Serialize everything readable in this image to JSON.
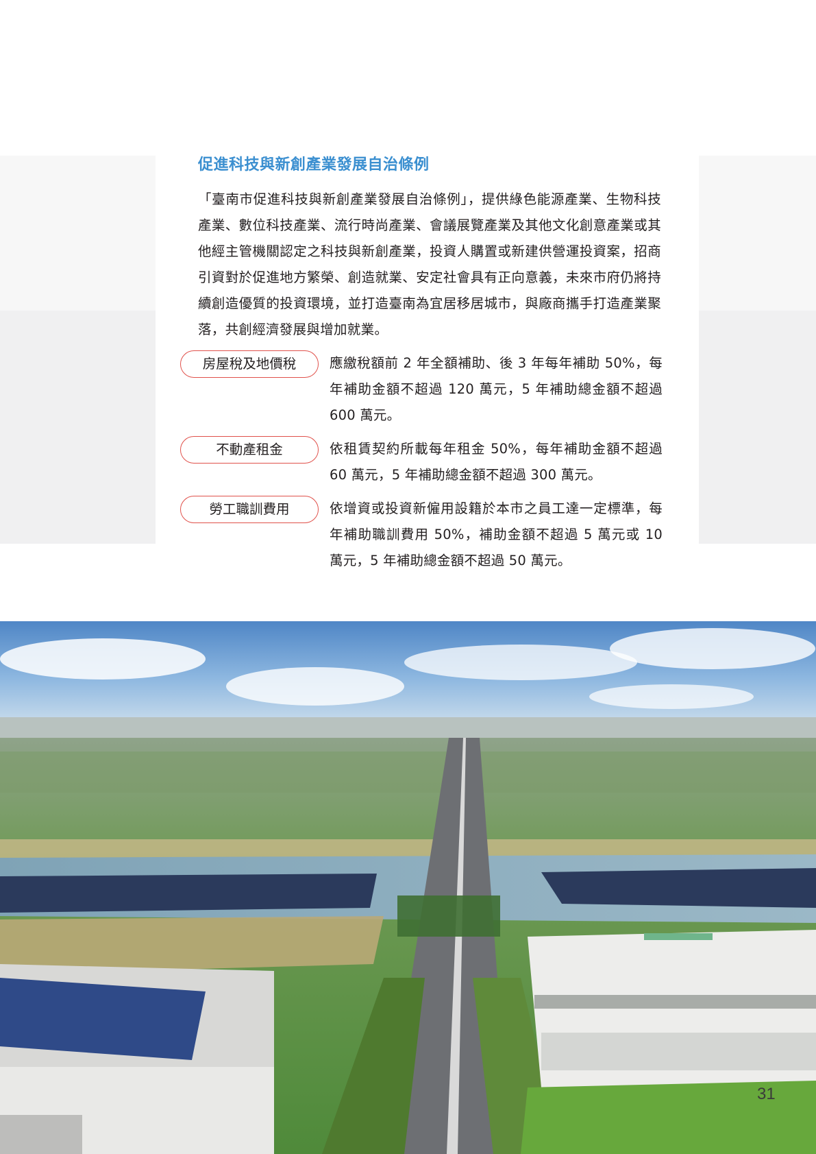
{
  "section": {
    "title": "促進科技與新創產業發展自治條例",
    "intro": "「臺南市促進科技與新創產業發展自治條例」，提供綠色能源產業、生物科技產業、數位科技產業、流行時尚產業、會議展覽產業及其他文化創意產業或其他經主管機關認定之科技與新創產業，投資人購置或新建供營運投資案，招商引資對於促進地方繁榮、創造就業、安定社會具有正向意義，未來市府仍將持續創造優質的投資環境，並打造臺南為宜居移居城市，與廠商攜手打造產業聚落，共創經濟發展與增加就業。"
  },
  "subsidies": [
    {
      "label": "房屋稅及地價稅",
      "text": "應繳稅額前 2 年全額補助、後 3 年每年補助 50%，每年補助金額不超過 120 萬元，5 年補助總金額不超過 600 萬元。"
    },
    {
      "label": "不動產租金",
      "text": "依租賃契約所載每年租金 50%，每年補助金額不超過 60 萬元，5 年補助總金額不超過 300 萬元。"
    },
    {
      "label": "勞工職訓費用",
      "text": "依增資或投資新僱用設籍於本市之員工達一定標準，每年補助職訓費用 50%，補助金額不超過 5 萬元或 10 萬元，5 年補助總金額不超過 50 萬元。"
    }
  ],
  "page_number": "31",
  "colors": {
    "title": "#3b8fd0",
    "pill_border": "#e0504a",
    "side_band": "#f0f0f1"
  }
}
